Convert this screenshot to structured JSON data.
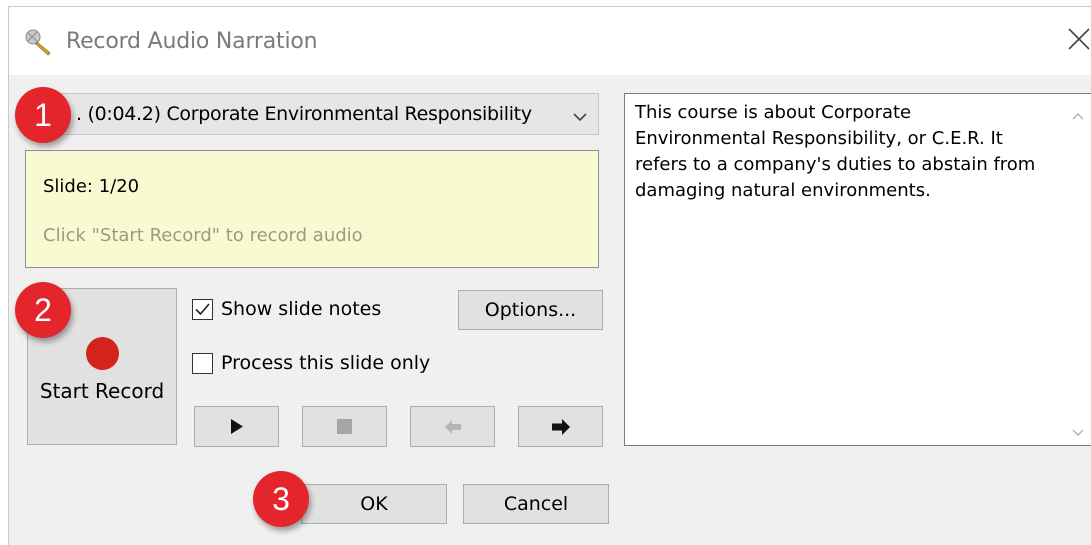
{
  "window": {
    "title": "Record Audio Narration",
    "title_icon": "microphone-icon",
    "close_icon": "close-icon"
  },
  "slide_selector": {
    "value": ". (0:04.2) Corporate Environmental Responsibility",
    "icon": "chevron-down-icon"
  },
  "info": {
    "slide_label": "Slide: 1/20",
    "hint": "Click \"Start Record\" to record audio"
  },
  "record_button": {
    "label": "Start Record",
    "icon": "record-dot-icon",
    "dot_color": "#d4231d"
  },
  "checkboxes": [
    {
      "label": "Show slide notes",
      "checked": true
    },
    {
      "label": "Process this slide only",
      "checked": false
    }
  ],
  "options_button": {
    "label": "Options..."
  },
  "playback_controls": [
    {
      "name": "play-button",
      "icon": "play-icon",
      "enabled": true
    },
    {
      "name": "stop-button",
      "icon": "stop-icon",
      "enabled": false
    },
    {
      "name": "previous-button",
      "icon": "arrow-left-icon",
      "enabled": false
    },
    {
      "name": "next-button",
      "icon": "arrow-right-icon",
      "enabled": true
    }
  ],
  "notes": {
    "text": "This course is about Corporate Environmental Responsibility, or C.E.R. It refers to a company's duties to abstain from damaging natural environments."
  },
  "footer": {
    "ok_label": "OK",
    "cancel_label": "Cancel"
  },
  "annotations": [
    "1",
    "2",
    "3"
  ],
  "colors": {
    "badge": "#e4252c",
    "info_background": "#fafad2",
    "dialog_background": "#f0f0f0"
  }
}
